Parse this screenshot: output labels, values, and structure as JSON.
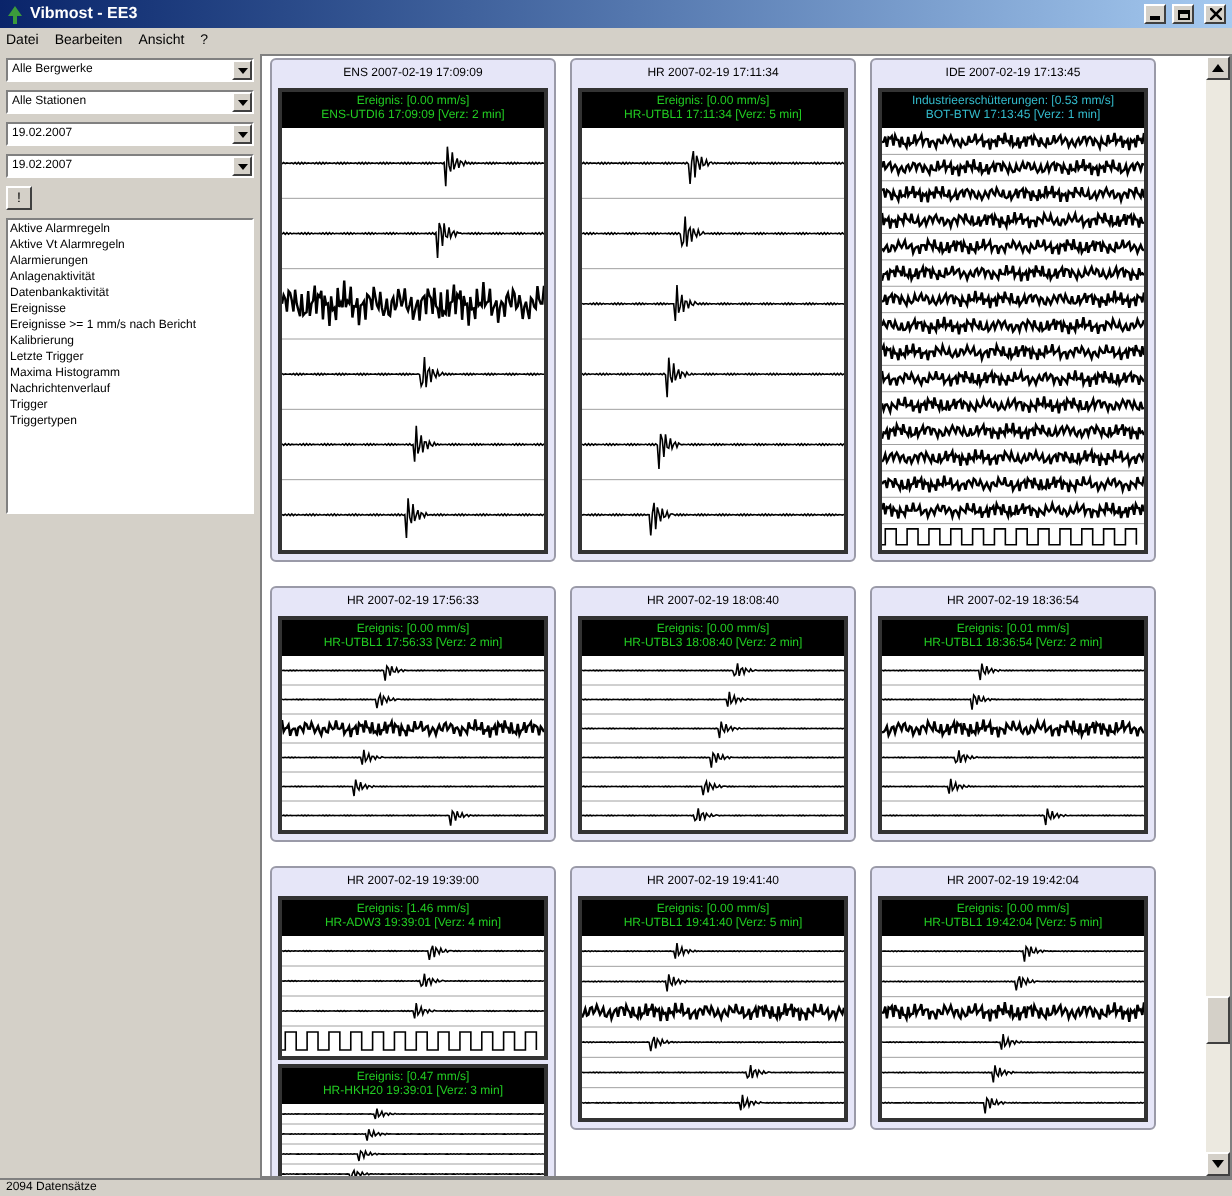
{
  "window": {
    "title": "Vibmost - EE3"
  },
  "menu": [
    "Datei",
    "Bearbeiten",
    "Ansicht",
    "?"
  ],
  "filters": [
    "Alle Bergwerke",
    "Alle Stationen",
    "19.02.2007",
    "19.02.2007"
  ],
  "apply_button": "!",
  "reports": [
    "Aktive Alarmregeln",
    "Aktive Vt Alarmregeln",
    "Alarmierungen",
    "Anlagenaktivität",
    "Datenbankaktivität",
    "Ereignisse",
    "Ereignisse >= 1 mm/s nach Bericht",
    "Kalibrierung",
    "Letzte Trigger",
    "Maxima Histogramm",
    "Nachrichtenverlauf",
    "Trigger",
    "Triggertypen"
  ],
  "card_rows": [
    [
      {
        "title": "ENS  2007-02-19 17:09:09",
        "events": [
          {
            "kind": "noisy",
            "line1": "Ereignis: [0.00 mm/s]",
            "line2": "ENS-UTDI6  17:09:09  [Verz: 2 min]",
            "color": "#22cc22"
          }
        ]
      },
      {
        "title": "HR  2007-02-19 17:11:34",
        "events": [
          {
            "kind": "quiet",
            "line1": "Ereignis: [0.00 mm/s]",
            "line2": "HR-UTBL1  17:11:34  [Verz: 5 min]",
            "color": "#22cc22"
          }
        ]
      },
      {
        "title": "IDE  2007-02-19 17:13:45",
        "events": [
          {
            "kind": "industrial",
            "line1": "Industrieerschütterungen: [0.53 mm/s]",
            "line2": "BOT-BTW  17:13:45  [Verz: 1 min]",
            "color": "#33bbcc"
          }
        ]
      }
    ],
    [
      {
        "title": "HR  2007-02-19 17:56:33",
        "events": [
          {
            "kind": "noisy",
            "line1": "Ereignis: [0.00 mm/s]",
            "line2": "HR-UTBL1  17:56:33  [Verz: 2 min]",
            "color": "#22cc22"
          }
        ]
      },
      {
        "title": "HR  2007-02-19 18:08:40",
        "events": [
          {
            "kind": "quiet",
            "line1": "Ereignis: [0.00 mm/s]",
            "line2": "HR-UTBL3  18:08:40  [Verz: 2 min]",
            "color": "#22cc22"
          }
        ]
      },
      {
        "title": "HR  2007-02-19 18:36:54",
        "events": [
          {
            "kind": "noisy",
            "line1": "Ereignis: [0.01 mm/s]",
            "line2": "HR-UTBL1  18:36:54  [Verz: 2 min]",
            "color": "#22cc22"
          }
        ]
      }
    ],
    [
      {
        "title": "HR  2007-02-19 19:39:00",
        "events": [
          {
            "kind": "calibration",
            "line1": "Ereignis: [1.46 mm/s]",
            "line2": "HR-ADW3  19:39:01  [Verz: 4 min]",
            "color": "#22cc22"
          },
          {
            "kind": "quiet",
            "line1": "Ereignis: [0.47 mm/s]",
            "line2": "HR-HKH20  19:39:01  [Verz: 3 min]",
            "color": "#22cc22"
          }
        ]
      },
      {
        "title": "HR  2007-02-19 19:41:40",
        "events": [
          {
            "kind": "noisy",
            "line1": "Ereignis: [0.00 mm/s]",
            "line2": "HR-UTBL1  19:41:40  [Verz: 5 min]",
            "color": "#22cc22"
          }
        ]
      },
      {
        "title": "HR  2007-02-19 19:42:04",
        "events": [
          {
            "kind": "noisy",
            "line1": "Ereignis: [0.00 mm/s]",
            "line2": "HR-UTBL1  19:42:04  [Verz: 5 min]",
            "color": "#22cc22"
          }
        ]
      }
    ]
  ],
  "status_bar": "2094 Datensätze"
}
